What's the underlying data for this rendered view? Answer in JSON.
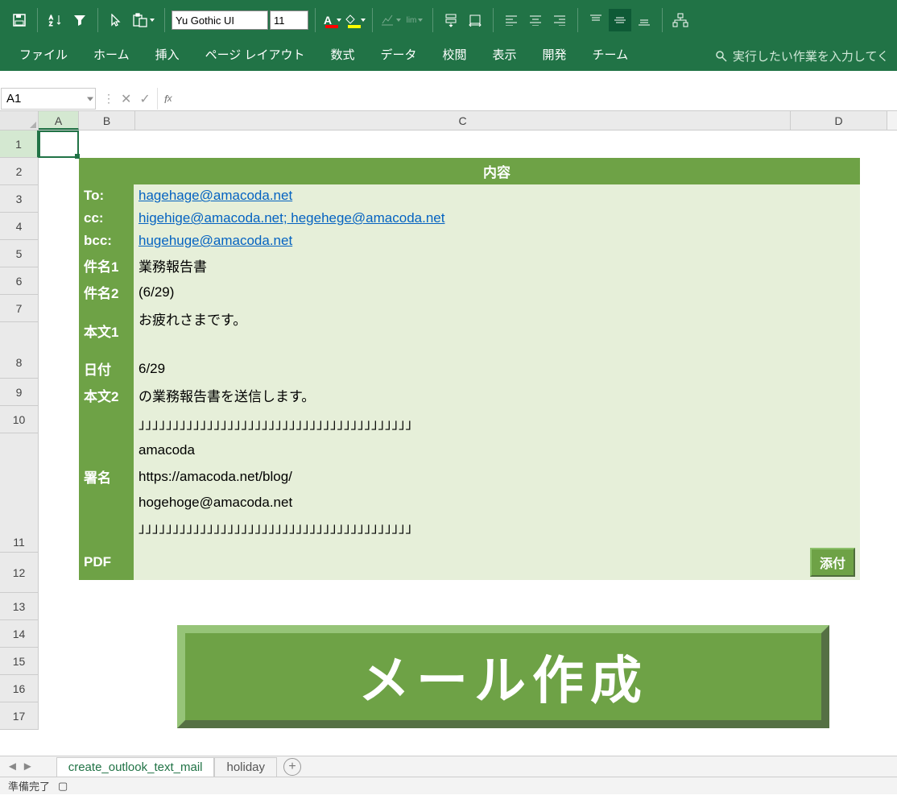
{
  "ribbon": {
    "font_name": "Yu Gothic UI",
    "font_size": "11"
  },
  "tabs": {
    "file": "ファイル",
    "home": "ホーム",
    "insert": "挿入",
    "layout": "ページ レイアウト",
    "formula": "数式",
    "data": "データ",
    "review": "校閲",
    "view": "表示",
    "dev": "開発",
    "team": "チーム",
    "search": "実行したい作業を入力してく"
  },
  "namebox": "A1",
  "columns": {
    "A": "A",
    "B": "B",
    "C": "C",
    "D": "D"
  },
  "rows": [
    "1",
    "2",
    "3",
    "4",
    "5",
    "6",
    "7",
    "8",
    "9",
    "10",
    "11",
    "12",
    "13",
    "14",
    "15",
    "16",
    "17"
  ],
  "table": {
    "header_c": "内容",
    "to_lbl": "To:",
    "to_val": "hagehage@amacoda.net",
    "cc_lbl": "cc:",
    "cc_val": "higehige@amacoda.net; hegehege@amacoda.net",
    "bcc_lbl": "bcc:",
    "bcc_val": "hugehuge@amacoda.net",
    "subj1_lbl": "件名1",
    "subj1_val": "業務報告書",
    "subj2_lbl": "件名2",
    "subj2_val": "(6/29)",
    "body1_lbl": "本文1",
    "body1_val": "お疲れさまです。",
    "date_lbl": "日付",
    "date_val": "6/29",
    "body2_lbl": "本文2",
    "body2_val": "の業務報告書を送信します。",
    "sig_lbl": "署名",
    "sig_val": "」」」」」」」」」」」」」」」」」」」」」」」」」」」」」」」」」」」」」」」」\namacoda\nhttps://amacoda.net/blog/\nhogehoge@amacoda.net\n」」」」」」」」」」」」」」」」」」」」」」」」」」」」」」」」」」」」」」」」",
    "pdf_lbl": "PDF",
    "attach_btn": "添付"
  },
  "big_button": "メール作成",
  "sheets": {
    "active": "create_outlook_text_mail",
    "other": "holiday"
  },
  "status": "準備完了"
}
